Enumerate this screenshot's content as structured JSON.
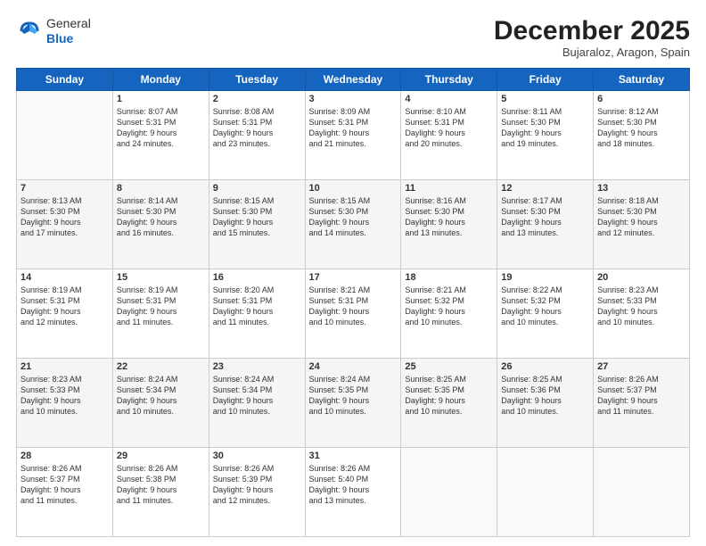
{
  "logo": {
    "general": "General",
    "blue": "Blue"
  },
  "title": "December 2025",
  "location": "Bujaraloz, Aragon, Spain",
  "weekdays": [
    "Sunday",
    "Monday",
    "Tuesday",
    "Wednesday",
    "Thursday",
    "Friday",
    "Saturday"
  ],
  "rows": [
    [
      {
        "day": "",
        "info": ""
      },
      {
        "day": "1",
        "info": "Sunrise: 8:07 AM\nSunset: 5:31 PM\nDaylight: 9 hours\nand 24 minutes."
      },
      {
        "day": "2",
        "info": "Sunrise: 8:08 AM\nSunset: 5:31 PM\nDaylight: 9 hours\nand 23 minutes."
      },
      {
        "day": "3",
        "info": "Sunrise: 8:09 AM\nSunset: 5:31 PM\nDaylight: 9 hours\nand 21 minutes."
      },
      {
        "day": "4",
        "info": "Sunrise: 8:10 AM\nSunset: 5:31 PM\nDaylight: 9 hours\nand 20 minutes."
      },
      {
        "day": "5",
        "info": "Sunrise: 8:11 AM\nSunset: 5:30 PM\nDaylight: 9 hours\nand 19 minutes."
      },
      {
        "day": "6",
        "info": "Sunrise: 8:12 AM\nSunset: 5:30 PM\nDaylight: 9 hours\nand 18 minutes."
      }
    ],
    [
      {
        "day": "7",
        "info": "Sunrise: 8:13 AM\nSunset: 5:30 PM\nDaylight: 9 hours\nand 17 minutes."
      },
      {
        "day": "8",
        "info": "Sunrise: 8:14 AM\nSunset: 5:30 PM\nDaylight: 9 hours\nand 16 minutes."
      },
      {
        "day": "9",
        "info": "Sunrise: 8:15 AM\nSunset: 5:30 PM\nDaylight: 9 hours\nand 15 minutes."
      },
      {
        "day": "10",
        "info": "Sunrise: 8:15 AM\nSunset: 5:30 PM\nDaylight: 9 hours\nand 14 minutes."
      },
      {
        "day": "11",
        "info": "Sunrise: 8:16 AM\nSunset: 5:30 PM\nDaylight: 9 hours\nand 13 minutes."
      },
      {
        "day": "12",
        "info": "Sunrise: 8:17 AM\nSunset: 5:30 PM\nDaylight: 9 hours\nand 13 minutes."
      },
      {
        "day": "13",
        "info": "Sunrise: 8:18 AM\nSunset: 5:30 PM\nDaylight: 9 hours\nand 12 minutes."
      }
    ],
    [
      {
        "day": "14",
        "info": "Sunrise: 8:19 AM\nSunset: 5:31 PM\nDaylight: 9 hours\nand 12 minutes."
      },
      {
        "day": "15",
        "info": "Sunrise: 8:19 AM\nSunset: 5:31 PM\nDaylight: 9 hours\nand 11 minutes."
      },
      {
        "day": "16",
        "info": "Sunrise: 8:20 AM\nSunset: 5:31 PM\nDaylight: 9 hours\nand 11 minutes."
      },
      {
        "day": "17",
        "info": "Sunrise: 8:21 AM\nSunset: 5:31 PM\nDaylight: 9 hours\nand 10 minutes."
      },
      {
        "day": "18",
        "info": "Sunrise: 8:21 AM\nSunset: 5:32 PM\nDaylight: 9 hours\nand 10 minutes."
      },
      {
        "day": "19",
        "info": "Sunrise: 8:22 AM\nSunset: 5:32 PM\nDaylight: 9 hours\nand 10 minutes."
      },
      {
        "day": "20",
        "info": "Sunrise: 8:23 AM\nSunset: 5:33 PM\nDaylight: 9 hours\nand 10 minutes."
      }
    ],
    [
      {
        "day": "21",
        "info": "Sunrise: 8:23 AM\nSunset: 5:33 PM\nDaylight: 9 hours\nand 10 minutes."
      },
      {
        "day": "22",
        "info": "Sunrise: 8:24 AM\nSunset: 5:34 PM\nDaylight: 9 hours\nand 10 minutes."
      },
      {
        "day": "23",
        "info": "Sunrise: 8:24 AM\nSunset: 5:34 PM\nDaylight: 9 hours\nand 10 minutes."
      },
      {
        "day": "24",
        "info": "Sunrise: 8:24 AM\nSunset: 5:35 PM\nDaylight: 9 hours\nand 10 minutes."
      },
      {
        "day": "25",
        "info": "Sunrise: 8:25 AM\nSunset: 5:35 PM\nDaylight: 9 hours\nand 10 minutes."
      },
      {
        "day": "26",
        "info": "Sunrise: 8:25 AM\nSunset: 5:36 PM\nDaylight: 9 hours\nand 10 minutes."
      },
      {
        "day": "27",
        "info": "Sunrise: 8:26 AM\nSunset: 5:37 PM\nDaylight: 9 hours\nand 11 minutes."
      }
    ],
    [
      {
        "day": "28",
        "info": "Sunrise: 8:26 AM\nSunset: 5:37 PM\nDaylight: 9 hours\nand 11 minutes."
      },
      {
        "day": "29",
        "info": "Sunrise: 8:26 AM\nSunset: 5:38 PM\nDaylight: 9 hours\nand 11 minutes."
      },
      {
        "day": "30",
        "info": "Sunrise: 8:26 AM\nSunset: 5:39 PM\nDaylight: 9 hours\nand 12 minutes."
      },
      {
        "day": "31",
        "info": "Sunrise: 8:26 AM\nSunset: 5:40 PM\nDaylight: 9 hours\nand 13 minutes."
      },
      {
        "day": "",
        "info": ""
      },
      {
        "day": "",
        "info": ""
      },
      {
        "day": "",
        "info": ""
      }
    ]
  ]
}
